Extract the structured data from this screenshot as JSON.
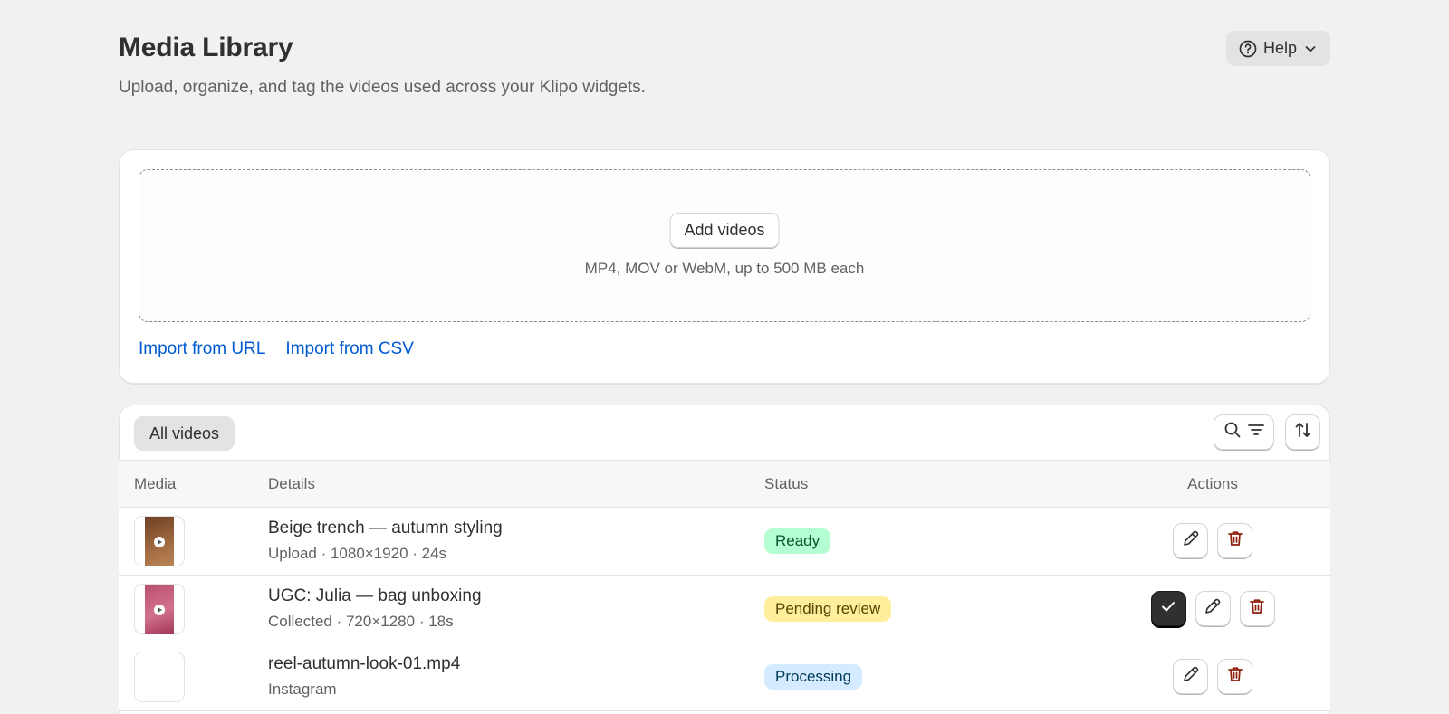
{
  "header": {
    "title": "Media Library",
    "subtitle": "Upload, organize, and tag the videos used across your Klipo widgets.",
    "help_label": "Help"
  },
  "upload": {
    "add_button_label": "Add videos",
    "hint": "MP4, MOV or WebM, up to 500 MB each",
    "import_url_label": "Import from URL",
    "import_csv_label": "Import from CSV"
  },
  "table": {
    "tab_label": "All videos",
    "columns": {
      "media": "Media",
      "details": "Details",
      "status": "Status",
      "actions": "Actions"
    },
    "rows": [
      {
        "title": "Beige trench — autumn styling",
        "meta": "Upload · 1080×1920 · 24s",
        "status": "Ready",
        "thumb_colors": [
          "#7a4a2a",
          "#b07a4e"
        ]
      },
      {
        "title": "UGC: Julia — bag unboxing",
        "meta": "Collected · 720×1280 · 18s",
        "status": "Pending review",
        "thumb_colors": [
          "#a8405e",
          "#d77d97"
        ]
      },
      {
        "title": "reel-autumn-look-01.mp4",
        "meta": "Instagram",
        "status": "Processing"
      }
    ]
  },
  "colors": {
    "link": "#005bd3",
    "delete_icon": "#8e1f0b",
    "ready_badge": "#b4fed2",
    "pending_badge": "#ffef9d",
    "processing_badge": "#d5ebff"
  }
}
